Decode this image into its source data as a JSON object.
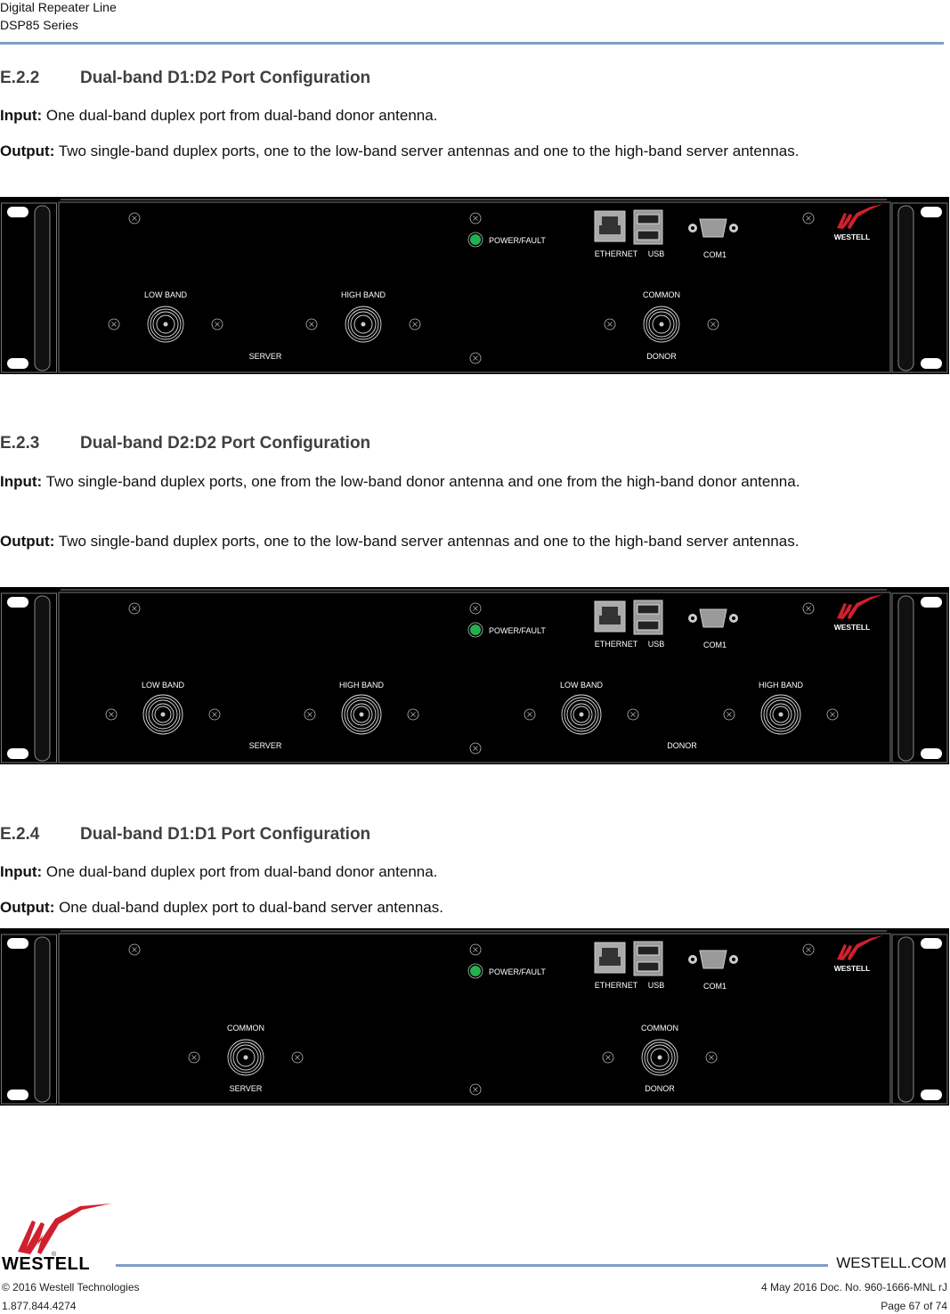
{
  "header": {
    "line1": "Digital Repeater Line",
    "line2": "DSP85 Series"
  },
  "sections": [
    {
      "number": "E.2.2",
      "title": "Dual-band D1:D2 Port Configuration",
      "input_label": "Input:",
      "input_text": " One dual-band duplex port from dual-band donor antenna.",
      "output_label": "Output:",
      "output_text": " Two single-band duplex ports, one to the low-band server antennas and one to the high-band server antennas.",
      "panel": {
        "led_label": "POWER/FAULT",
        "led_color": "#22b14c",
        "ports": [
          "ETHERNET",
          "USB",
          "COM1"
        ],
        "brand": "WESTELL",
        "server_label": "SERVER",
        "donor_label": "DONOR",
        "server_connectors": [
          "LOW BAND",
          "HIGH BAND"
        ],
        "donor_connectors": [
          "COMMON"
        ]
      }
    },
    {
      "number": "E.2.3",
      "title": "Dual-band D2:D2 Port Configuration",
      "input_label": "Input:",
      "input_text": " Two single-band duplex ports, one from the low-band donor antenna and one from the high-band donor antenna.",
      "output_label": "Output:",
      "output_text": " Two single-band duplex ports, one to the low-band server antennas and one to the high-band server antennas.",
      "panel": {
        "led_label": "POWER/FAULT",
        "led_color": "#22b14c",
        "ports": [
          "ETHERNET",
          "USB",
          "COM1"
        ],
        "brand": "WESTELL",
        "server_label": "SERVER",
        "donor_label": "DONOR",
        "server_connectors": [
          "LOW BAND",
          "HIGH BAND"
        ],
        "donor_connectors": [
          "LOW BAND",
          "HIGH BAND"
        ]
      }
    },
    {
      "number": "E.2.4",
      "title": "Dual-band D1:D1 Port Configuration",
      "input_label": "Input:",
      "input_text": " One dual-band duplex port from dual-band donor antenna.",
      "output_label": "Output:",
      "output_text": " One dual-band duplex port to dual-band server antennas.",
      "panel": {
        "led_label": "POWER/FAULT",
        "led_color": "#22b14c",
        "ports": [
          "ETHERNET",
          "USB",
          "COM1"
        ],
        "brand": "WESTELL",
        "server_label": "SERVER",
        "donor_label": "DONOR",
        "server_connectors": [
          "COMMON"
        ],
        "donor_connectors": [
          "COMMON"
        ]
      }
    }
  ],
  "footer": {
    "brand": "WESTELL",
    "url": "WESTELL.COM",
    "copyright": "© 2016 Westell Technologies",
    "phone": "1.877.844.4274",
    "doc_info": "4 May 2016 Doc. No. 960-1666-MNL rJ",
    "page": "Page 67 of 74"
  },
  "colors": {
    "rule": "#7f9fc5",
    "brand_red": "#d0202e",
    "heading": "#404040"
  }
}
